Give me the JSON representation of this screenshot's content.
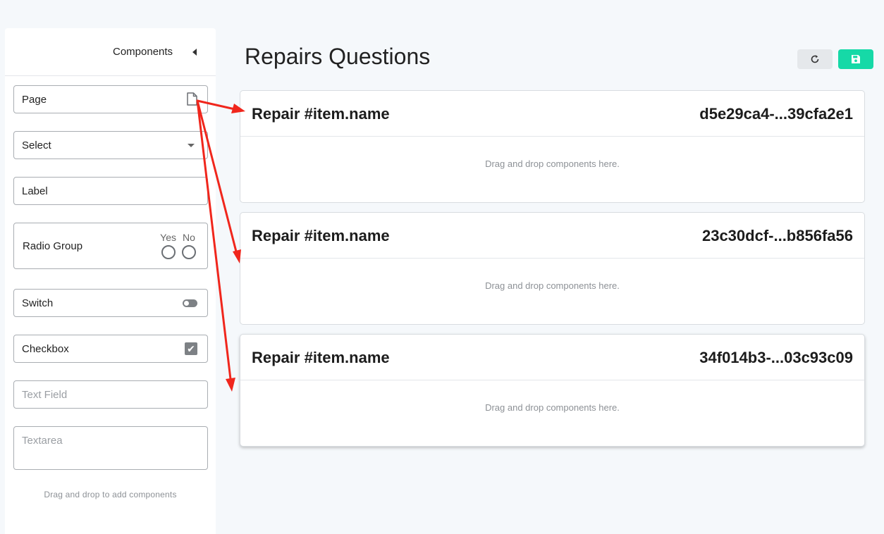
{
  "sidebar": {
    "title": "Components",
    "footer": "Drag and drop to add components",
    "components": {
      "page": {
        "label": "Page",
        "icon": "file-icon"
      },
      "select": {
        "label": "Select",
        "icon": "caret-down-icon"
      },
      "label": {
        "label": "Label"
      },
      "radio_group": {
        "label": "Radio Group",
        "options": [
          "Yes",
          "No"
        ]
      },
      "switch": {
        "label": "Switch",
        "icon": "toggle-icon"
      },
      "checkbox": {
        "label": "Checkbox",
        "icon": "checkbox-checked-icon"
      },
      "text_field": {
        "placeholder": "Text Field"
      },
      "textarea": {
        "placeholder": "Textarea"
      }
    }
  },
  "main": {
    "title": "Repairs Questions",
    "toolbar": {
      "refresh_icon": "refresh-icon",
      "save_icon": "save-icon",
      "save_color": "#16d9a7"
    },
    "cards": [
      {
        "title": "Repair #item.name",
        "id": "d5e29ca4-...39cfa2e1",
        "drop_text": "Drag and drop components here."
      },
      {
        "title": "Repair #item.name",
        "id": "23c30dcf-...b856fa56",
        "drop_text": "Drag and drop components here."
      },
      {
        "title": "Repair #item.name",
        "id": "34f014b3-...03c93c09",
        "drop_text": "Drag and drop components here."
      }
    ]
  },
  "annotation_color": "#f0261c"
}
